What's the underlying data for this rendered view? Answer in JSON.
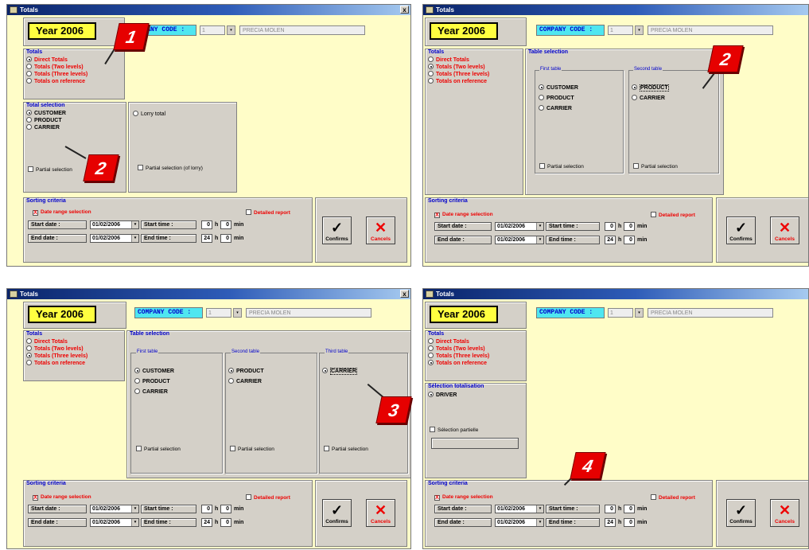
{
  "window": {
    "title": "Totals",
    "close": "x",
    "year": "Year  2006"
  },
  "company": {
    "label": "COMPANY CODE :",
    "code": "1",
    "name": "PRECIA MOLEN",
    "arrow": "▾"
  },
  "totals": {
    "title": "Totals",
    "items": [
      "Direct Totals",
      "Totals (Two levels)",
      "Totals (Three levels)",
      "Totals on reference"
    ]
  },
  "total_selection": {
    "title": "Total selection",
    "items": [
      "CUSTOMER",
      "PRODUCT",
      "CARRIER"
    ],
    "lorry": "Lorry total",
    "partial": "Partial selection",
    "partial_lorry": "Partial selection (of lorry)"
  },
  "table_selection": {
    "title": "Table selection",
    "first": "First table",
    "second": "Second table",
    "third": "Third table",
    "items1": [
      "CUSTOMER",
      "PRODUCT",
      "CARRIER"
    ],
    "items2": [
      "PRODUCT",
      "CARRIER"
    ],
    "items3": [
      "CARRIER"
    ],
    "partial": "Partial selection"
  },
  "driver_selection": {
    "title": "Sélection totalisation",
    "item": "DRIVER",
    "partial": "Sélection partielle"
  },
  "sorting": {
    "title": "Sorting criteria",
    "date_range": "Date range selection",
    "detailed": "Detailed report",
    "start_date_label": "Start date   :",
    "end_date_label": "End date     :",
    "start_date": "01/02/2006",
    "end_date": "01/02/2006",
    "start_time_label": "Start time  :",
    "end_time_label": "End time     :",
    "start_h": "0",
    "start_min": "0",
    "end_h": "24",
    "end_min": "0",
    "h": "h",
    "min": "min",
    "check": "X"
  },
  "buttons": {
    "confirm": "Confirms",
    "cancel": "Cancels",
    "confirm_glyph": "✓",
    "cancel_glyph": "✕"
  },
  "markers": {
    "m1": "1",
    "m2a": "2",
    "m2b": "2",
    "m3": "3",
    "m4": "4"
  }
}
